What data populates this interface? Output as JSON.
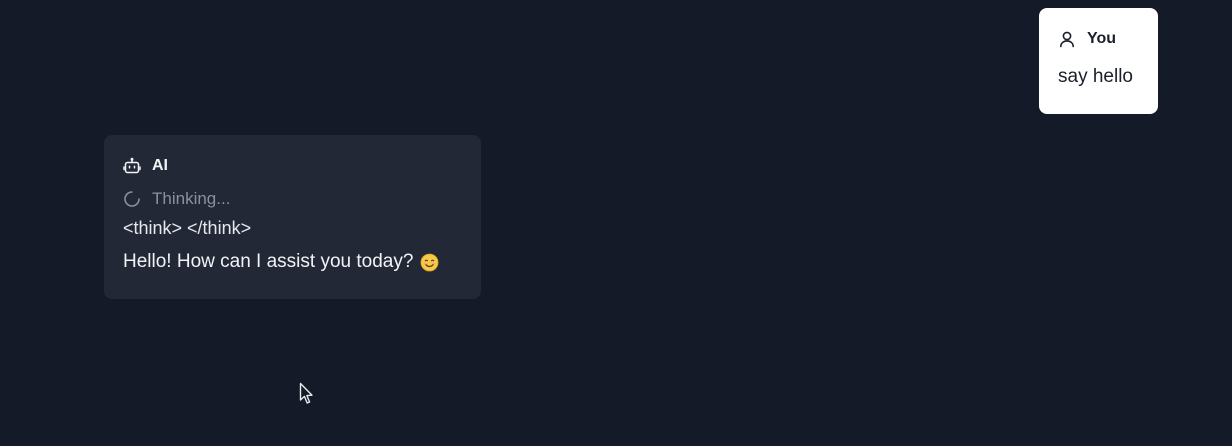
{
  "user_message": {
    "author": "You",
    "text": "say hello",
    "icon": "user-icon"
  },
  "ai_message": {
    "author": "AI",
    "icon": "robot-icon",
    "status_icon": "spinner-icon",
    "status": "Thinking...",
    "think_tags": "<think> </think>",
    "text": "Hello! How can I assist you today?",
    "emoji": "smiling-face-emoji"
  },
  "colors": {
    "background": "#141a27",
    "ai_bubble": "#232836",
    "user_bubble": "#ffffff",
    "muted_text": "#8a909c"
  }
}
